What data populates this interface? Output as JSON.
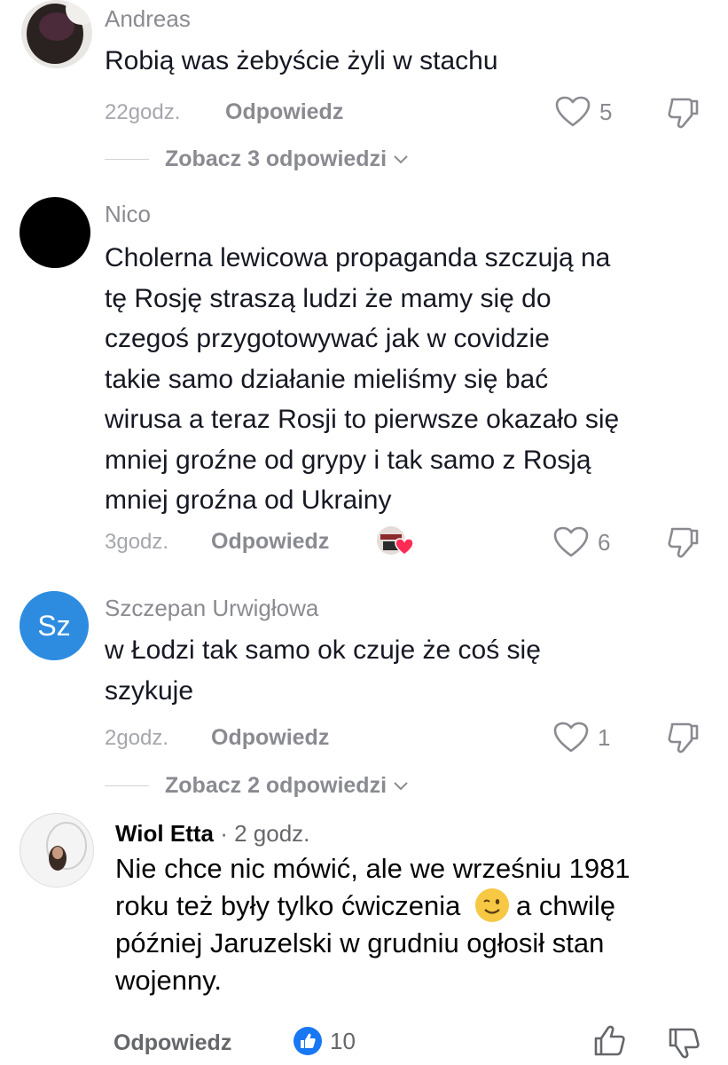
{
  "comments": [
    {
      "username": "Andreas",
      "text": "Robią was żebyście żyli w stachu",
      "time": "22godz.",
      "reply_label": "Odpowiedz",
      "like_count": "5",
      "view_replies": "Zobacz 3 odpowiedzi"
    },
    {
      "username": "Nico",
      "text_lines": [
        "Cholerna lewicowa propaganda szczują na",
        "tę Rosję straszą ludzi że mamy się do",
        "czegoś przygotowywać jak w covidzie",
        "takie samo działanie mieliśmy się bać",
        "wirusa a teraz Rosji to pierwsze okazało się",
        "mniej groźne od grypy i tak samo z Rosją",
        "mniej groźna od Ukrainy"
      ],
      "time": "3godz.",
      "reply_label": "Odpowiedz",
      "like_count": "6"
    },
    {
      "username": "Szczepan Urwigłowa",
      "avatar_initials": "Sz",
      "text_lines": [
        "w Łodzi tak samo ok czuje że coś się",
        "szykuje"
      ],
      "time": "2godz.",
      "reply_label": "Odpowiedz",
      "like_count": "1",
      "view_replies": "Zobacz 2 odpowiedzi"
    }
  ],
  "facebook_comment": {
    "username": "Wiol Etta",
    "time": " · 2 godz.",
    "text_lines": [
      "Nie chce nic mówić, ale we wrześniu 1981",
      "roku też były tylko ćwiczenia",
      "a chwilę",
      "później Jaruzelski w grudniu ogłosił stan",
      "wojenny."
    ],
    "emoji": "winking-face",
    "reply_label": "Odpowiedz",
    "reaction_count": "10"
  },
  "colors": {
    "muted": "#8a8b91",
    "avatar_blue": "#2d8ce0",
    "fb_blue": "#1877f2",
    "heart_red": "#fe2c55"
  }
}
